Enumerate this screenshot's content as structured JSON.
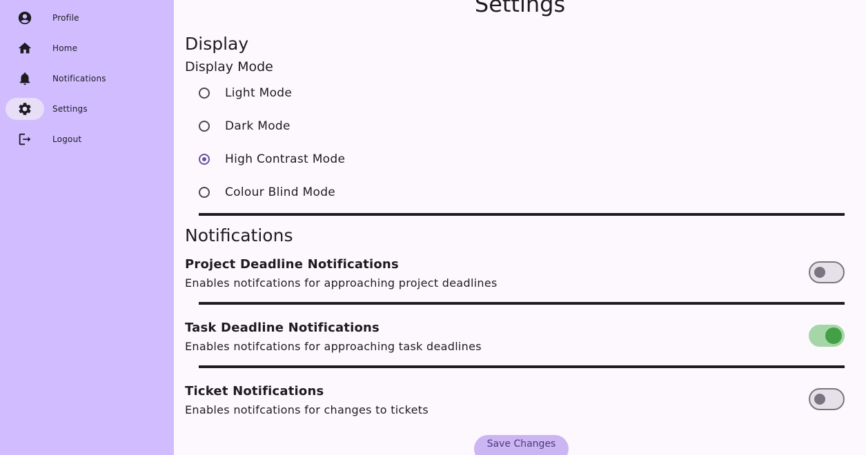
{
  "sidebar": {
    "items": [
      {
        "label": "Profile",
        "icon": "account-circle-icon"
      },
      {
        "label": "Home",
        "icon": "home-icon"
      },
      {
        "label": "Notifications",
        "icon": "bell-icon"
      },
      {
        "label": "Settings",
        "icon": "gear-icon",
        "active": true
      },
      {
        "label": "Logout",
        "icon": "logout-icon"
      }
    ]
  },
  "main": {
    "page_title": "Settings",
    "display": {
      "section_title": "Display",
      "mode_title": "Display Mode",
      "options": [
        {
          "label": "Light Mode",
          "selected": false
        },
        {
          "label": "Dark Mode",
          "selected": false
        },
        {
          "label": "High Contrast Mode",
          "selected": true
        },
        {
          "label": "Colour Blind Mode",
          "selected": false
        }
      ]
    },
    "notifications": {
      "section_title": "Notifications",
      "settings": [
        {
          "title": "Project Deadline Notifications",
          "description": "Enables notifcations for approaching project deadlines",
          "enabled": false
        },
        {
          "title": "Task Deadline Notifications",
          "description": "Enables notifcations for approaching task deadlines",
          "enabled": true
        },
        {
          "title": "Ticket Notifications",
          "description": "Enables notifcations for changes to tickets",
          "enabled": false
        }
      ]
    },
    "save_label": "Save Changes"
  },
  "colors": {
    "sidebar_bg": "#d0bcff",
    "active_indicator": "#e8def8",
    "accent": "#6750a4",
    "toggle_on": "#43a047",
    "page_bg": "#fdf8fd"
  }
}
